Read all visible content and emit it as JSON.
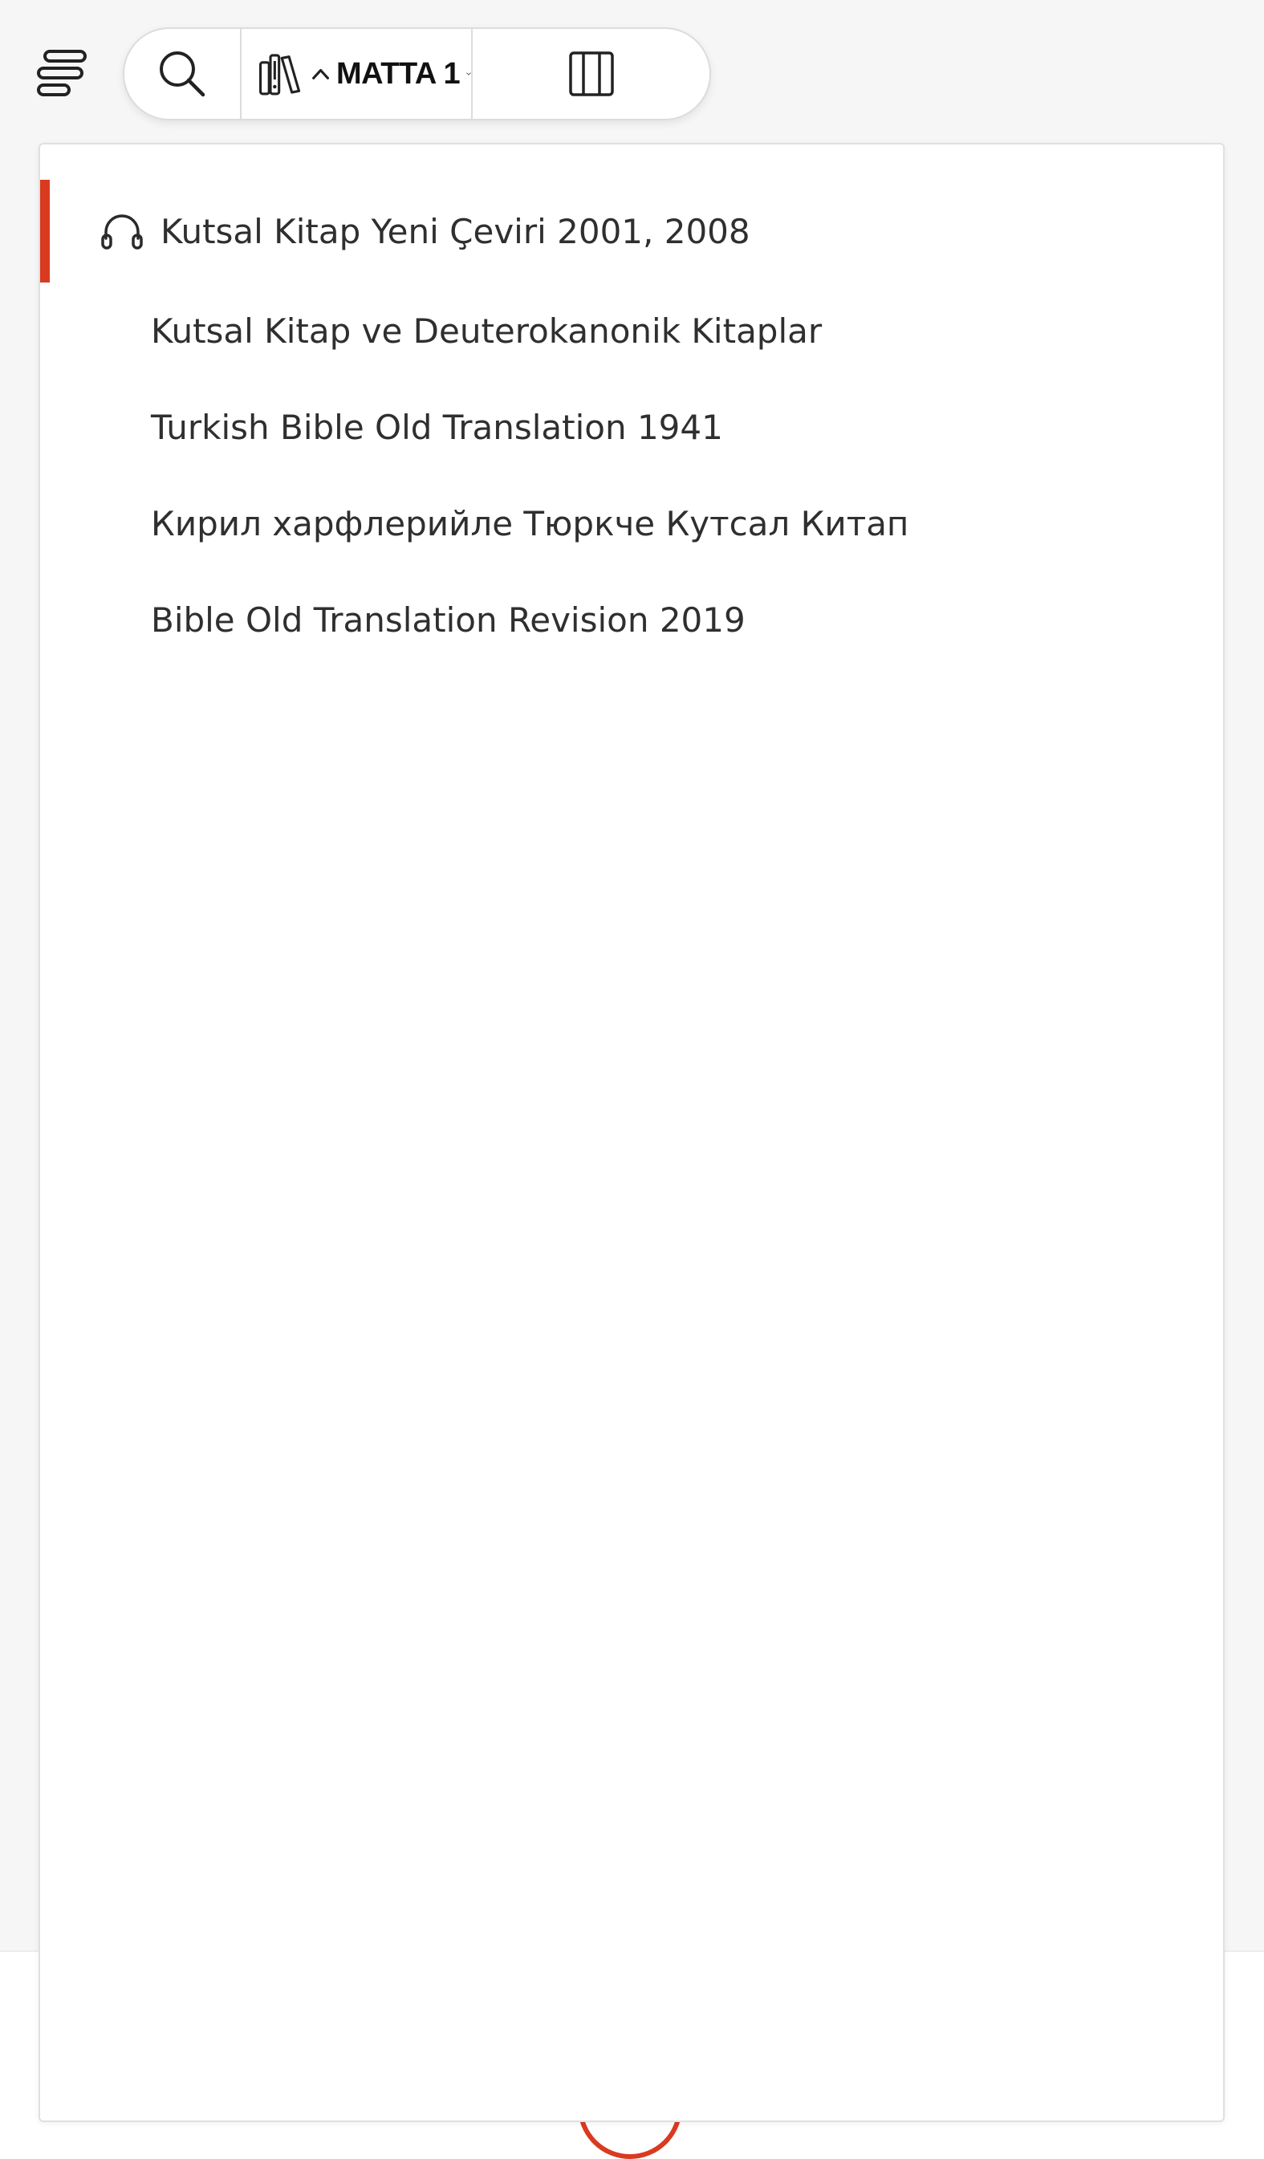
{
  "toolbar": {
    "book_chapter": "MATTA 1"
  },
  "versions": [
    {
      "label": "Kutsal Kitap Yeni Çeviri 2001, 2008",
      "has_audio": true,
      "selected": true
    },
    {
      "label": "Kutsal Kitap ve Deuterokanonik Kitaplar",
      "has_audio": false,
      "selected": false
    },
    {
      "label": "Turkish Bible Old Translation 1941",
      "has_audio": false,
      "selected": false
    },
    {
      "label": "Кирил харфлерийле Тюркче Кутсал Китап",
      "has_audio": false,
      "selected": false
    },
    {
      "label": "Bible Old Translation Revision 2019",
      "has_audio": false,
      "selected": false
    }
  ],
  "colors": {
    "accent": "#d93a20",
    "text": "#2f2f2f",
    "background": "#f6f6f6"
  },
  "icons": {
    "menu": "menu-lines-icon",
    "search": "search-icon",
    "version": "library-books-icon",
    "parallel": "parallel-columns-icon",
    "audio": "headphones-icon"
  }
}
